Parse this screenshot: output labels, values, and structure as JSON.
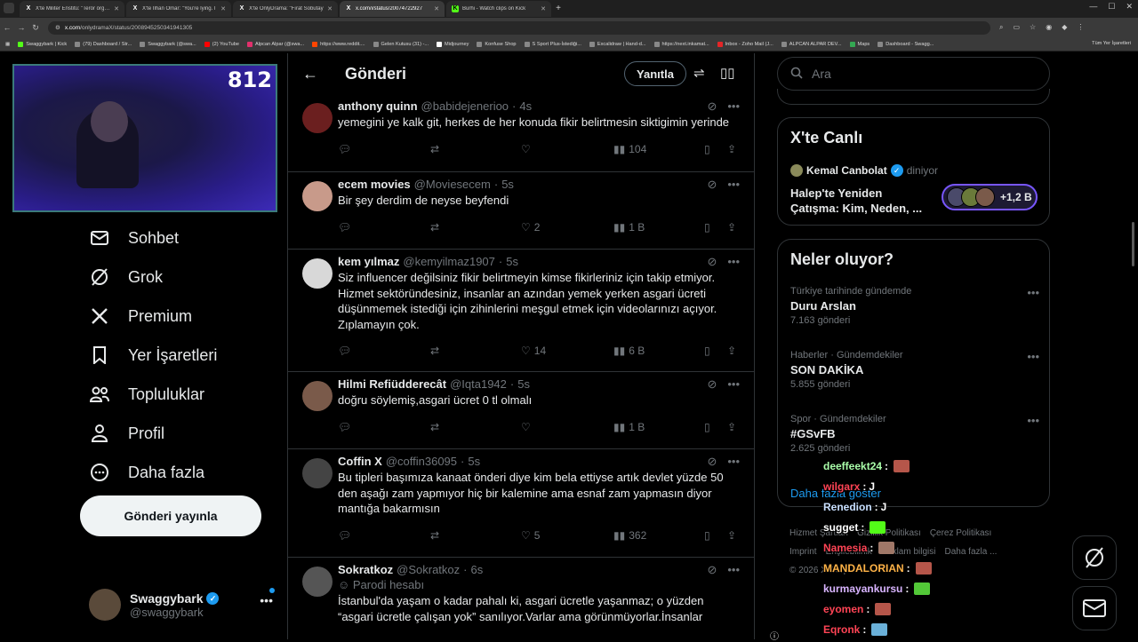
{
  "browser": {
    "tabs": [
      {
        "title": "X'te Militer Enstitü: \"Terör örgütü",
        "favicon": "X",
        "active": false
      },
      {
        "title": "X'te İlhan Omar: \"You're lying. I",
        "favicon": "X",
        "active": false
      },
      {
        "title": "X'te OnlyDrama: \"Fırat Sobutay",
        "favicon": "X",
        "active": false
      },
      {
        "title": "x.com/i/status/20074722927",
        "favicon": "X",
        "active": true
      },
      {
        "title": "Burhi - Watch clips on Kick",
        "favicon": "K",
        "active": false
      }
    ],
    "url_host": "x.com",
    "url_path": "/onlydramaX/status/2008945250341941305",
    "bookmarks": [
      "Swaggybark | Kick",
      "(79) Dashboard / Str...",
      "Swaggybark (@swa...",
      "(2) YouTube",
      "Alpcan Alpar (@swa...",
      "https://www.reddit....",
      "Gelen Kutusu (31) -...",
      "Midjourney",
      "Konfuse Shop",
      "S Sport Plus-İstediği...",
      "Excalidraw | Hand-d...",
      "https://next.inkamat...",
      "Inbox - Zoho Mail (J...",
      "ALPCAN ALPAR DEV...",
      "Maps",
      "Dashboard - Swagg..."
    ],
    "bookmarks_all": "Tüm Yer İşaretleri"
  },
  "stream": {
    "viewer_count": "812"
  },
  "nav": {
    "items": [
      {
        "label": "Sohbet",
        "icon": "mail-icon"
      },
      {
        "label": "Grok",
        "icon": "grok-icon"
      },
      {
        "label": "Premium",
        "icon": "x-logo-icon"
      },
      {
        "label": "Yer İşaretleri",
        "icon": "bookmark-icon"
      },
      {
        "label": "Topluluklar",
        "icon": "communities-icon"
      },
      {
        "label": "Profil",
        "icon": "profile-icon"
      },
      {
        "label": "Daha fazla",
        "icon": "more-circle-icon"
      }
    ],
    "post_button": "Gönderi yayınla"
  },
  "account": {
    "name": "Swaggybark",
    "handle": "@swaggybark"
  },
  "header": {
    "title": "Gönderi",
    "reply_button": "Yanıtla"
  },
  "tweets": [
    {
      "name": "anthony quinn",
      "handle": "@babidejenerioo",
      "time": "4s",
      "body": "yemegini ye kalk git, herkes de her konuda fikir belirtmesin siktigimin yerinde",
      "likes": "",
      "views": "104",
      "avatar_color": "#6b1f1f",
      "parody": ""
    },
    {
      "name": "ecem movies",
      "handle": "@Moviesecem",
      "time": "5s",
      "body": "Bir şey derdim de neyse beyfendi",
      "likes": "2",
      "views": "1 B",
      "avatar_color": "#c89a8a",
      "parody": ""
    },
    {
      "name": "kem yılmaz",
      "handle": "@kemyilmaz1907",
      "time": "5s",
      "body": "Siz influencer değilsiniz fikir belirtmeyin kimse fikirleriniz için takip etmiyor. Hizmet sektöründesiniz, insanlar an azından yemek yerken asgari ücreti düşünmemek istediği için zihinlerini meşgul etmek için videolarınızı açıyor. Zıplamayın çok.",
      "likes": "14",
      "views": "6 B",
      "avatar_color": "#d8d8d8",
      "parody": ""
    },
    {
      "name": "Hilmi Refiüdderecât",
      "handle": "@Iqta1942",
      "time": "5s",
      "body": "doğru söylemiş,asgari ücret 0 tl olmalı",
      "likes": "",
      "views": "1 B",
      "avatar_color": "#7a5a4a",
      "parody": ""
    },
    {
      "name": "Coffin X",
      "handle": "@coffin36095",
      "time": "5s",
      "body": "Bu tipleri başımıza kanaat önderi diye kim bela ettiyse artık devlet yüzde 50 den aşağı zam yapmıyor hiç bir kalemine ama esnaf zam yapmasın diyor mantığa bakarmısın",
      "likes": "5",
      "views": "362",
      "avatar_color": "#444444",
      "parody": ""
    },
    {
      "name": "Sokratkoz",
      "handle": "@Sokratkoz",
      "time": "6s",
      "body": "İstanbul'da yaşam o kadar pahalı ki, asgari ücretle yaşanmaz; o yüzden “asgari ücretle çalışan yok” sanılıyor.Varlar ama görünmüyorlar.İnsanlar",
      "likes": "",
      "views": "",
      "avatar_color": "#555555",
      "parody": "Parodi hesabı"
    }
  ],
  "right": {
    "search_placeholder": "Ara",
    "live": {
      "title": "X'te Canlı",
      "host": "Kemal Canbolat",
      "status": "diniyor",
      "headline": "Halep'te Yeniden Çatışma: Kim, Neden, ...",
      "listeners": "+1,2 B"
    },
    "trends_title": "Neler oluyor?",
    "trends": [
      {
        "context": "Türkiye tarihinde gündemde",
        "topic": "Duru Arslan",
        "count": "7.163 gönderi"
      },
      {
        "context": "Haberler · Gündemdekiler",
        "topic": "SON DAKİKA",
        "count": "5.855 gönderi"
      },
      {
        "context": "Spor · Gündemdekiler",
        "topic": "#GSvFB",
        "count": "2.625 gönderi"
      }
    ],
    "show_more": "Daha fazla göster",
    "footer": [
      "Hizmet Şartları",
      "Gizlilik Politikası",
      "Çerez Politikası",
      "Imprint",
      "Erişilebilirlik",
      "Reklam bilgisi",
      "Daha fazla ...",
      "© 2026 X Corp."
    ]
  },
  "chat": [
    {
      "user": "deeffeekt24",
      "text": "",
      "color": "#aaffaa",
      "emote": "#b5564a"
    },
    {
      "user": "wilgarx",
      "text": "J",
      "color": "#ff4455",
      "emote": ""
    },
    {
      "user": "Renedion",
      "text": "J",
      "color": "#c9e0ff",
      "emote": ""
    },
    {
      "user": "sugget",
      "text": "",
      "color": "#ffffff",
      "emote": "#53fc18"
    },
    {
      "user": "Namesia",
      "text": "",
      "color": "#ff4455",
      "emote": "#a07868"
    },
    {
      "user": "MANDALORIAN",
      "text": "",
      "color": "#ffb347",
      "emote": "#b5564a"
    },
    {
      "user": "kurmayankursu",
      "text": "",
      "color": "#d8b4ff",
      "emote": "#53c838"
    },
    {
      "user": "eyomen",
      "text": "",
      "color": "#ff4455",
      "emote": "#b5564a"
    },
    {
      "user": "Eqronk",
      "text": "",
      "color": "#ff4455",
      "emote": "#6ab0d8"
    }
  ]
}
